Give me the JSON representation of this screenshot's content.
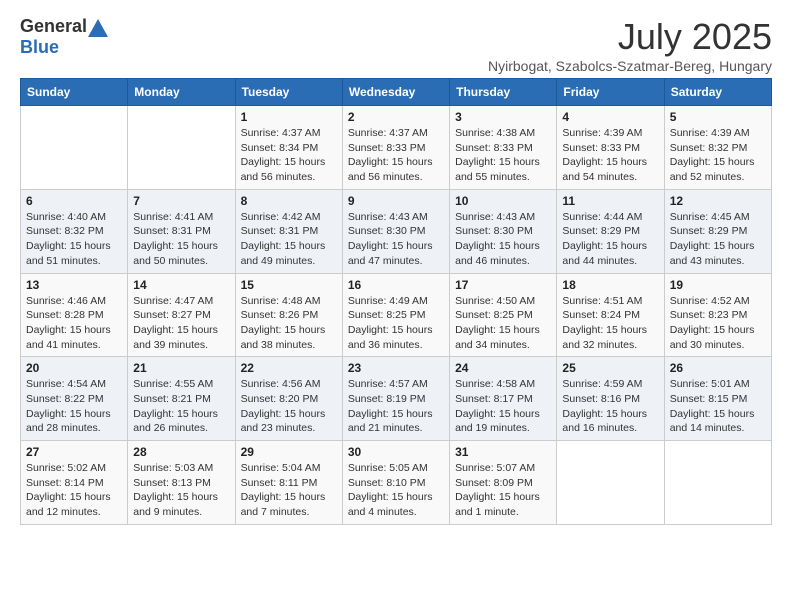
{
  "header": {
    "logo_general": "General",
    "logo_blue": "Blue",
    "title": "July 2025",
    "subtitle": "Nyirbogat, Szabolcs-Szatmar-Bereg, Hungary"
  },
  "days_of_week": [
    "Sunday",
    "Monday",
    "Tuesday",
    "Wednesday",
    "Thursday",
    "Friday",
    "Saturday"
  ],
  "weeks": [
    [
      {
        "day": "",
        "info": ""
      },
      {
        "day": "",
        "info": ""
      },
      {
        "day": "1",
        "sunrise": "Sunrise: 4:37 AM",
        "sunset": "Sunset: 8:34 PM",
        "daylight": "Daylight: 15 hours and 56 minutes."
      },
      {
        "day": "2",
        "sunrise": "Sunrise: 4:37 AM",
        "sunset": "Sunset: 8:33 PM",
        "daylight": "Daylight: 15 hours and 56 minutes."
      },
      {
        "day": "3",
        "sunrise": "Sunrise: 4:38 AM",
        "sunset": "Sunset: 8:33 PM",
        "daylight": "Daylight: 15 hours and 55 minutes."
      },
      {
        "day": "4",
        "sunrise": "Sunrise: 4:39 AM",
        "sunset": "Sunset: 8:33 PM",
        "daylight": "Daylight: 15 hours and 54 minutes."
      },
      {
        "day": "5",
        "sunrise": "Sunrise: 4:39 AM",
        "sunset": "Sunset: 8:32 PM",
        "daylight": "Daylight: 15 hours and 52 minutes."
      }
    ],
    [
      {
        "day": "6",
        "sunrise": "Sunrise: 4:40 AM",
        "sunset": "Sunset: 8:32 PM",
        "daylight": "Daylight: 15 hours and 51 minutes."
      },
      {
        "day": "7",
        "sunrise": "Sunrise: 4:41 AM",
        "sunset": "Sunset: 8:31 PM",
        "daylight": "Daylight: 15 hours and 50 minutes."
      },
      {
        "day": "8",
        "sunrise": "Sunrise: 4:42 AM",
        "sunset": "Sunset: 8:31 PM",
        "daylight": "Daylight: 15 hours and 49 minutes."
      },
      {
        "day": "9",
        "sunrise": "Sunrise: 4:43 AM",
        "sunset": "Sunset: 8:30 PM",
        "daylight": "Daylight: 15 hours and 47 minutes."
      },
      {
        "day": "10",
        "sunrise": "Sunrise: 4:43 AM",
        "sunset": "Sunset: 8:30 PM",
        "daylight": "Daylight: 15 hours and 46 minutes."
      },
      {
        "day": "11",
        "sunrise": "Sunrise: 4:44 AM",
        "sunset": "Sunset: 8:29 PM",
        "daylight": "Daylight: 15 hours and 44 minutes."
      },
      {
        "day": "12",
        "sunrise": "Sunrise: 4:45 AM",
        "sunset": "Sunset: 8:29 PM",
        "daylight": "Daylight: 15 hours and 43 minutes."
      }
    ],
    [
      {
        "day": "13",
        "sunrise": "Sunrise: 4:46 AM",
        "sunset": "Sunset: 8:28 PM",
        "daylight": "Daylight: 15 hours and 41 minutes."
      },
      {
        "day": "14",
        "sunrise": "Sunrise: 4:47 AM",
        "sunset": "Sunset: 8:27 PM",
        "daylight": "Daylight: 15 hours and 39 minutes."
      },
      {
        "day": "15",
        "sunrise": "Sunrise: 4:48 AM",
        "sunset": "Sunset: 8:26 PM",
        "daylight": "Daylight: 15 hours and 38 minutes."
      },
      {
        "day": "16",
        "sunrise": "Sunrise: 4:49 AM",
        "sunset": "Sunset: 8:25 PM",
        "daylight": "Daylight: 15 hours and 36 minutes."
      },
      {
        "day": "17",
        "sunrise": "Sunrise: 4:50 AM",
        "sunset": "Sunset: 8:25 PM",
        "daylight": "Daylight: 15 hours and 34 minutes."
      },
      {
        "day": "18",
        "sunrise": "Sunrise: 4:51 AM",
        "sunset": "Sunset: 8:24 PM",
        "daylight": "Daylight: 15 hours and 32 minutes."
      },
      {
        "day": "19",
        "sunrise": "Sunrise: 4:52 AM",
        "sunset": "Sunset: 8:23 PM",
        "daylight": "Daylight: 15 hours and 30 minutes."
      }
    ],
    [
      {
        "day": "20",
        "sunrise": "Sunrise: 4:54 AM",
        "sunset": "Sunset: 8:22 PM",
        "daylight": "Daylight: 15 hours and 28 minutes."
      },
      {
        "day": "21",
        "sunrise": "Sunrise: 4:55 AM",
        "sunset": "Sunset: 8:21 PM",
        "daylight": "Daylight: 15 hours and 26 minutes."
      },
      {
        "day": "22",
        "sunrise": "Sunrise: 4:56 AM",
        "sunset": "Sunset: 8:20 PM",
        "daylight": "Daylight: 15 hours and 23 minutes."
      },
      {
        "day": "23",
        "sunrise": "Sunrise: 4:57 AM",
        "sunset": "Sunset: 8:19 PM",
        "daylight": "Daylight: 15 hours and 21 minutes."
      },
      {
        "day": "24",
        "sunrise": "Sunrise: 4:58 AM",
        "sunset": "Sunset: 8:17 PM",
        "daylight": "Daylight: 15 hours and 19 minutes."
      },
      {
        "day": "25",
        "sunrise": "Sunrise: 4:59 AM",
        "sunset": "Sunset: 8:16 PM",
        "daylight": "Daylight: 15 hours and 16 minutes."
      },
      {
        "day": "26",
        "sunrise": "Sunrise: 5:01 AM",
        "sunset": "Sunset: 8:15 PM",
        "daylight": "Daylight: 15 hours and 14 minutes."
      }
    ],
    [
      {
        "day": "27",
        "sunrise": "Sunrise: 5:02 AM",
        "sunset": "Sunset: 8:14 PM",
        "daylight": "Daylight: 15 hours and 12 minutes."
      },
      {
        "day": "28",
        "sunrise": "Sunrise: 5:03 AM",
        "sunset": "Sunset: 8:13 PM",
        "daylight": "Daylight: 15 hours and 9 minutes."
      },
      {
        "day": "29",
        "sunrise": "Sunrise: 5:04 AM",
        "sunset": "Sunset: 8:11 PM",
        "daylight": "Daylight: 15 hours and 7 minutes."
      },
      {
        "day": "30",
        "sunrise": "Sunrise: 5:05 AM",
        "sunset": "Sunset: 8:10 PM",
        "daylight": "Daylight: 15 hours and 4 minutes."
      },
      {
        "day": "31",
        "sunrise": "Sunrise: 5:07 AM",
        "sunset": "Sunset: 8:09 PM",
        "daylight": "Daylight: 15 hours and 1 minute."
      },
      {
        "day": "",
        "info": ""
      },
      {
        "day": "",
        "info": ""
      }
    ]
  ]
}
